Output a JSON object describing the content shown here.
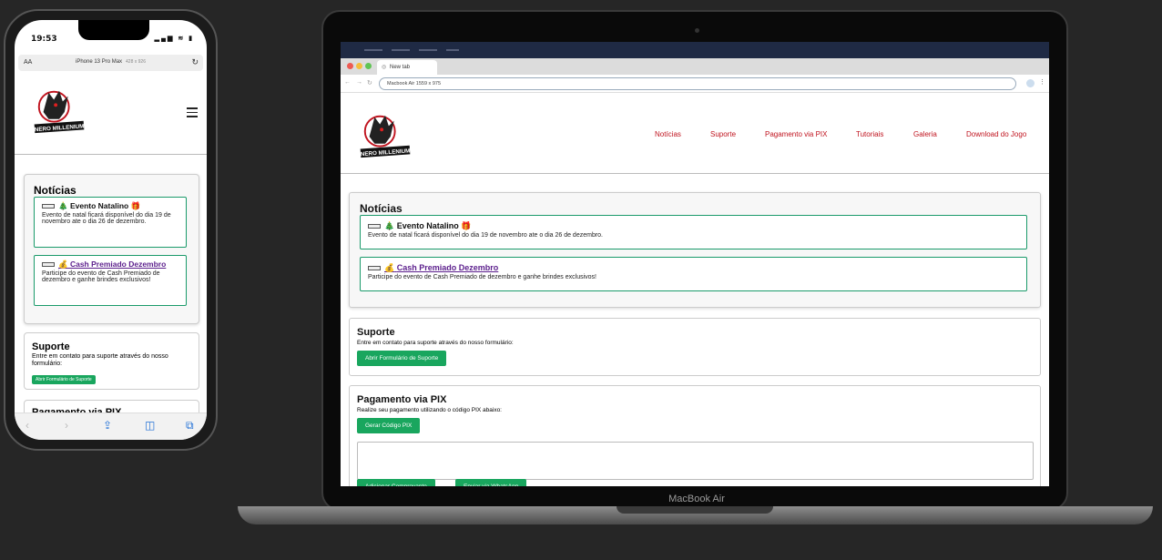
{
  "phone": {
    "time": "19:53",
    "status_icons": "▂▄▆ ≋ ▮",
    "aa": "AA",
    "device": "iPhone 13 Pro Max",
    "size": "428 x 926",
    "reload_icon": "↻",
    "nav": {
      "back": "‹",
      "forward": "›",
      "share": "⇪",
      "bookmarks": "◫",
      "tabs": "⧉"
    }
  },
  "laptop": {
    "label": "MacBook Air",
    "apple": "",
    "tab_title": "New tab",
    "address": "Macbook Air  1559 x 975",
    "nav_back": "←",
    "nav_forward": "→",
    "nav_reload": "↻",
    "more": "⋮"
  },
  "site": {
    "logo_text": "NERO MILLENIUM",
    "nav": [
      "Notícias",
      "Suporte",
      "Pagamento via PIX",
      "Tutoriais",
      "Galeria",
      "Download do Jogo"
    ],
    "news": {
      "heading": "Notícias",
      "items": [
        {
          "emoji": "🎄",
          "title": "Evento Natalino",
          "trail": "🎁",
          "text": "Evento de natal ficará disponível do dia 19 de novembro ate o dia 26 de dezembro."
        },
        {
          "emoji": "💰",
          "title": "Cash Premiado Dezembro",
          "text": "Participe do evento de Cash Premiado de dezembro e ganhe brindes exclusivos!"
        }
      ]
    },
    "support": {
      "heading": "Suporte",
      "text": "Entre em contato para suporte através do nosso formulário:",
      "button": "Abrir Formulário de Suporte"
    },
    "pix": {
      "heading": "Pagamento via PIX",
      "text": "Realize seu pagamento utilizando o código PIX abaixo:",
      "button": "Gerar Código PIX",
      "button2": "Adicionar Comprovante",
      "button3": "Enviar via WhatsApp"
    }
  },
  "colors": {
    "accent_green": "#19a65e",
    "nav_red": "#c0141f",
    "link_purple": "#5b1e8c"
  }
}
